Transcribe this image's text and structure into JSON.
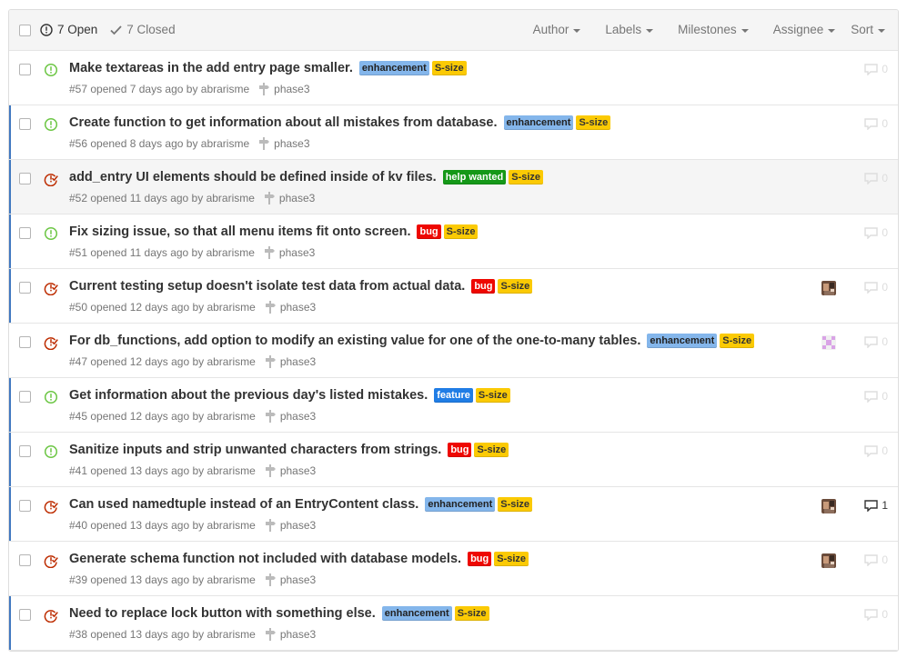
{
  "header": {
    "open_count": "7 Open",
    "closed_count": "7 Closed",
    "filters": [
      "Author",
      "Labels",
      "Milestones",
      "Assignee",
      "Sort"
    ]
  },
  "colors": {
    "open": "#6cc644",
    "closed": "#bd2c00",
    "enhancement": "#84b6eb",
    "S-size": "#fbca04",
    "help wanted": "#159818",
    "bug": "#ee0701",
    "feature": "#207de5"
  },
  "issues": [
    {
      "title": "Make textareas in the add entry page smaller.",
      "state": "open",
      "labels": [
        "enhancement",
        "S-size"
      ],
      "meta": "#57 opened 7 days ago by abrarisme",
      "milestone": "phase3",
      "avatar": "",
      "comments": "0",
      "highlight": false,
      "bar": false
    },
    {
      "title": "Create function to get information about all mistakes from database.",
      "state": "open",
      "labels": [
        "enhancement",
        "S-size"
      ],
      "meta": "#56 opened 8 days ago by abrarisme",
      "milestone": "phase3",
      "avatar": "",
      "comments": "0",
      "highlight": false,
      "bar": true
    },
    {
      "title": "add_entry UI elements should be defined inside of kv files.",
      "state": "closed",
      "labels": [
        "help wanted",
        "S-size"
      ],
      "meta": "#52 opened 11 days ago by abrarisme",
      "milestone": "phase3",
      "avatar": "",
      "comments": "0",
      "highlight": true,
      "bar": true
    },
    {
      "title": "Fix sizing issue, so that all menu items fit onto screen.",
      "state": "open",
      "labels": [
        "bug",
        "S-size"
      ],
      "meta": "#51 opened 11 days ago by abrarisme",
      "milestone": "phase3",
      "avatar": "",
      "comments": "0",
      "highlight": false,
      "bar": true
    },
    {
      "title": "Current testing setup doesn't isolate test data from actual data.",
      "state": "closed",
      "labels": [
        "bug",
        "S-size"
      ],
      "meta": "#50 opened 12 days ago by abrarisme",
      "milestone": "phase3",
      "avatar": "photo",
      "comments": "0",
      "highlight": false,
      "bar": true
    },
    {
      "title": "For db_functions, add option to modify an existing value for one of the one-to-many tables.",
      "state": "closed",
      "labels": [
        "enhancement",
        "S-size"
      ],
      "meta": "#47 opened 12 days ago by abrarisme",
      "milestone": "phase3",
      "avatar": "identicon",
      "comments": "0",
      "highlight": false,
      "bar": false
    },
    {
      "title": "Get information about the previous day's listed mistakes.",
      "state": "open",
      "labels": [
        "feature",
        "S-size"
      ],
      "meta": "#45 opened 12 days ago by abrarisme",
      "milestone": "phase3",
      "avatar": "",
      "comments": "0",
      "highlight": false,
      "bar": true
    },
    {
      "title": "Sanitize inputs and strip unwanted characters from strings.",
      "state": "open",
      "labels": [
        "bug",
        "S-size"
      ],
      "meta": "#41 opened 13 days ago by abrarisme",
      "milestone": "phase3",
      "avatar": "",
      "comments": "0",
      "highlight": false,
      "bar": true
    },
    {
      "title": "Can used namedtuple instead of an EntryContent class.",
      "state": "closed",
      "labels": [
        "enhancement",
        "S-size"
      ],
      "meta": "#40 opened 13 days ago by abrarisme",
      "milestone": "phase3",
      "avatar": "photo",
      "comments": "1",
      "highlight": false,
      "bar": true
    },
    {
      "title": "Generate schema function not included with database models.",
      "state": "closed",
      "labels": [
        "bug",
        "S-size"
      ],
      "meta": "#39 opened 13 days ago by abrarisme",
      "milestone": "phase3",
      "avatar": "photo",
      "comments": "0",
      "highlight": false,
      "bar": false
    },
    {
      "title": "Need to replace lock button with something else.",
      "state": "closed",
      "labels": [
        "enhancement",
        "S-size"
      ],
      "meta": "#38 opened 13 days ago by abrarisme",
      "milestone": "phase3",
      "avatar": "",
      "comments": "0",
      "highlight": false,
      "bar": true
    }
  ]
}
